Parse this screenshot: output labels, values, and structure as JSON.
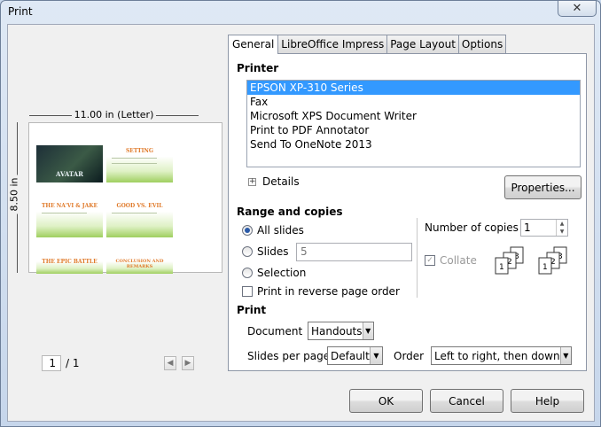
{
  "window": {
    "title": "Print",
    "close_glyph": "✕"
  },
  "preview": {
    "width_label": "11.00 in (Letter)",
    "height_label": "8.50 in",
    "current_page": "1",
    "total_pages": "/ 1",
    "thumbnails": [
      "AVATAR",
      "SETTING",
      "THE NA'VI & JAKE",
      "GOOD  VS.  EVIL",
      "THE EPIC BATTLE",
      "CONCLUSION AND REMARKS"
    ]
  },
  "tabs": [
    "General",
    "LibreOffice Impress",
    "Page Layout",
    "Options"
  ],
  "printer": {
    "heading": "Printer",
    "items": [
      "EPSON XP-310 Series",
      "Fax",
      "Microsoft XPS Document Writer",
      "Print to PDF Annotator",
      "Send To OneNote 2013"
    ],
    "selected_index": 0,
    "details_label": "Details",
    "properties_label": "Properties..."
  },
  "range": {
    "heading": "Range and copies",
    "all_slides": "All slides",
    "slides": "Slides",
    "slides_value": "5",
    "selection": "Selection",
    "reverse": "Print in reverse page order",
    "copies_label": "Number of copies",
    "copies_value": "1",
    "collate_label": "Collate"
  },
  "print_section": {
    "heading": "Print",
    "document_label": "Document",
    "document_value": "Handouts",
    "slides_per_page_label": "Slides per page",
    "slides_per_page_value": "Default",
    "order_label": "Order",
    "order_value": "Left to right, then down"
  },
  "buttons": {
    "ok": "OK",
    "cancel": "Cancel",
    "help": "Help"
  }
}
